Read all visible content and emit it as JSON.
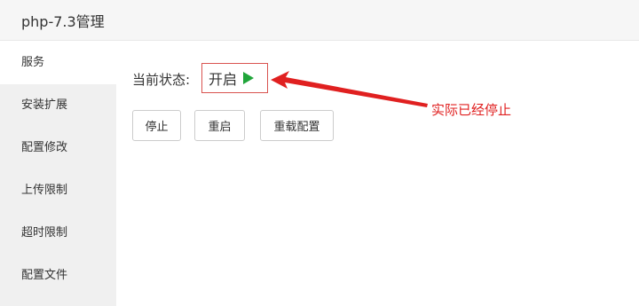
{
  "window": {
    "title": "php-7.3管理"
  },
  "sidebar": {
    "items": [
      {
        "label": "服务"
      },
      {
        "label": "安装扩展"
      },
      {
        "label": "配置修改"
      },
      {
        "label": "上传限制"
      },
      {
        "label": "超时限制"
      },
      {
        "label": "配置文件"
      }
    ]
  },
  "main": {
    "status_label": "当前状态:",
    "status_value": "开启",
    "annotation": "实际已经停止",
    "buttons": {
      "stop": "停止",
      "restart": "重启",
      "reload": "重载配置"
    }
  },
  "colors": {
    "running": "#20a53a",
    "annotation": "#e02020"
  },
  "icons": {
    "status": "play-icon",
    "annotation": "arrow-icon"
  }
}
